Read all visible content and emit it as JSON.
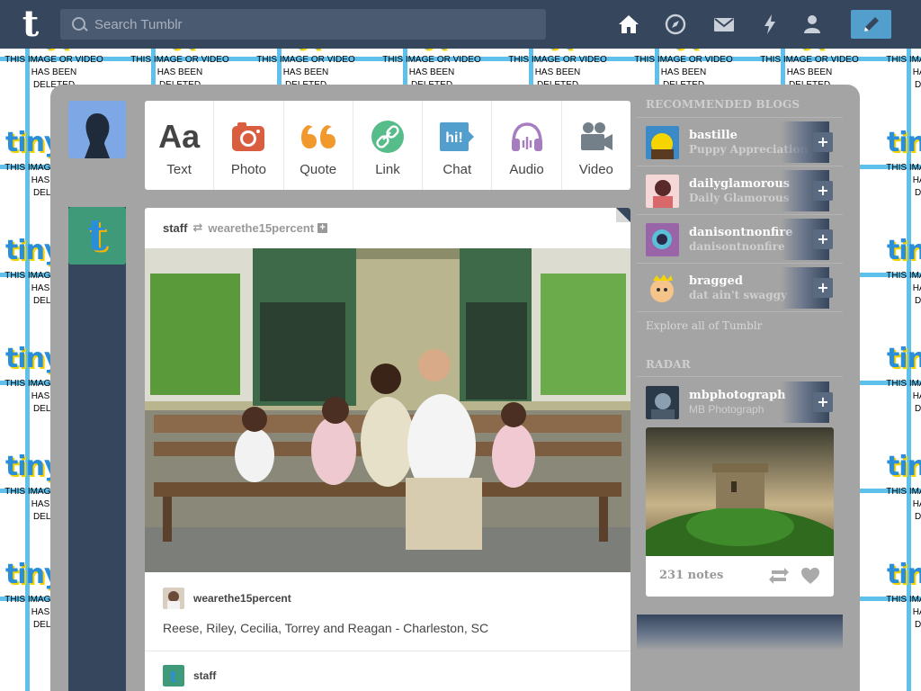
{
  "search": {
    "placeholder": "Search Tumblr"
  },
  "nav": {
    "icons": [
      "home-icon",
      "explore-compass-icon",
      "inbox-envelope-icon",
      "activity-lightning-icon",
      "account-person-icon",
      "compose-pencil-icon"
    ]
  },
  "logo": {
    "letter": "t"
  },
  "background": {
    "logo_text": "tinypic",
    "notice_line1": "This image or video",
    "notice_line2": "has been",
    "notice_line3": "deleted"
  },
  "post_types": [
    {
      "label": "Text",
      "icon": "text-aa-icon",
      "color": "#444444"
    },
    {
      "label": "Photo",
      "icon": "camera-icon",
      "color": "#d95e40"
    },
    {
      "label": "Quote",
      "icon": "quote-icon",
      "color": "#f2992e"
    },
    {
      "label": "Link",
      "icon": "link-icon",
      "color": "#56bc8a"
    },
    {
      "label": "Chat",
      "icon": "chat-hi-icon",
      "color": "#529ecc"
    },
    {
      "label": "Audio",
      "icon": "headphones-icon",
      "color": "#a77dc2"
    },
    {
      "label": "Video",
      "icon": "video-camera-icon",
      "color": "#748089"
    }
  ],
  "post": {
    "author": "staff",
    "source": "wearethe15percent",
    "caption_user": "wearethe15percent",
    "caption": "Reese, Riley, Cecilia, Torrey and Reagan - Charleston, SC",
    "next_user": "staff"
  },
  "sidebar": {
    "recommended_heading": "Recommended Blogs",
    "blogs": [
      {
        "name": "bastille",
        "desc": "Puppy Appreciation"
      },
      {
        "name": "dailyglamorous",
        "desc": "Daily Glamorous"
      },
      {
        "name": "danisontnonfire",
        "desc": "danisontnonfire"
      },
      {
        "name": "bragged",
        "desc": "dat ain't swaggy"
      }
    ],
    "explore_link": "Explore all of Tumblr",
    "radar_heading": "Radar",
    "radar": {
      "name": "mbphotograph",
      "desc": "MB Photograph",
      "notes": "231 notes"
    }
  },
  "colors": {
    "dashboard_bg": "#36465d",
    "accent_blue": "#529ecc",
    "panel_gray": "#a4a4a4"
  }
}
